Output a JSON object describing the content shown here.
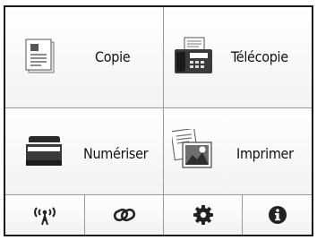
{
  "tiles": {
    "copy": {
      "label": "Copie",
      "icon": "copy-document-icon"
    },
    "fax": {
      "label": "Télécopie",
      "icon": "fax-machine-icon"
    },
    "scan": {
      "label": "Numériser",
      "icon": "scanner-icon"
    },
    "print": {
      "label": "Imprimer",
      "icon": "print-photo-icon"
    }
  },
  "bottom_bar": [
    {
      "icon": "wireless-network-icon"
    },
    {
      "icon": "link-icon"
    },
    {
      "icon": "gear-icon"
    },
    {
      "icon": "info-icon"
    }
  ],
  "colors": {
    "border": "#1a1a1a",
    "divider": "#9a9a9a",
    "icon": "#222222"
  }
}
